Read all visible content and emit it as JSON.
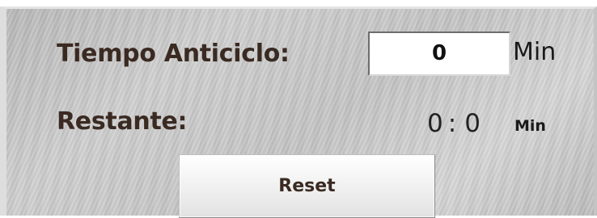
{
  "panel": {
    "anticycle_time_label": "Tiempo Anticiclo:",
    "anticycle_time_value": "0",
    "anticycle_time_unit": "Min",
    "remaining_label": "Restante:",
    "remaining_minutes": "0",
    "remaining_separator": ":",
    "remaining_seconds": "0",
    "remaining_unit": "Min",
    "reset_label": "Reset"
  }
}
